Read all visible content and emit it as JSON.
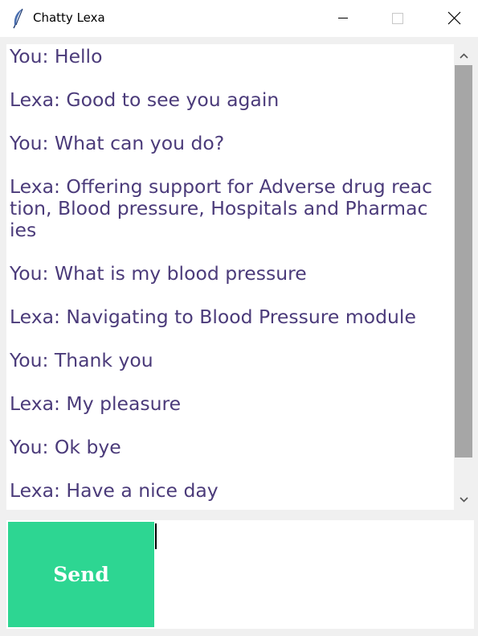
{
  "window": {
    "title": "Chatty Lexa",
    "app_icon": "feather-icon",
    "controls": [
      "minimize-icon",
      "maximize-icon",
      "close-icon"
    ]
  },
  "chat": {
    "messages": [
      "You: Hello",
      "Lexa: Good to see you again",
      "You: What can you do?",
      "Lexa: Offering support for Adverse drug reac\ntion, Blood pressure, Hospitals and Pharmac\nies",
      "You: What is my blood pressure",
      "Lexa: Navigating to Blood Pressure module",
      "You: Thank you",
      "Lexa: My pleasure",
      "You: Ok bye",
      "Lexa: Have a nice day"
    ]
  },
  "scrollbar": {
    "up_icon": "chevron-up-icon",
    "down_icon": "chevron-down-icon"
  },
  "composer": {
    "send_label": "Send",
    "input_value": ""
  },
  "colors": {
    "text": "#4b3b7a",
    "send_button": "#2dd692",
    "scroll_thumb": "#a6a6a6"
  }
}
